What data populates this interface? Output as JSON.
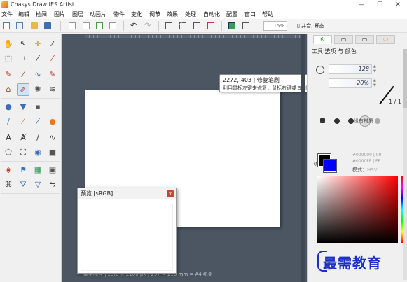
{
  "window": {
    "title": "Chasys Draw IES Artist",
    "min": "—",
    "max": "☐",
    "close": "✕"
  },
  "menu": [
    "文件",
    "编辑",
    "检阅",
    "图片",
    "图层",
    "动画片",
    "物件",
    "变化",
    "调节",
    "效果",
    "处理",
    "自动化",
    "配置",
    "窗口",
    "帮助"
  ],
  "toolbar": {
    "zoom": "15%",
    "merge_label": "并合, 幂态"
  },
  "tooltip": {
    "line1": "2272,-403 | 修复笔刷",
    "line2": "利用鼠标左键来修复，鼠标右键或 Shift 来配置参考"
  },
  "statusbar": {
    "text": "幅平面片 | 29/0 × 2100 px | 297 × 210 mm = A4 纸张"
  },
  "preview": {
    "title": "预览 [sRGB]",
    "close": "x"
  },
  "panel": {
    "tabs": [
      "⚙",
      "▭",
      "▭",
      "⬭"
    ],
    "title": "工具 选项 与 颜色",
    "size_value": "128",
    "opacity_value": "20%",
    "ratio": "1 / 1",
    "no_texture": "没有材质",
    "fg_hex": "#000000 | 00",
    "bg_hex": "#0000FF | FF",
    "mode_label": "模式：",
    "mode_value": "HSV"
  },
  "colors": {
    "foreground": "#000000",
    "background": "#0000ff",
    "accent": "#7fb2de"
  },
  "watermark": "最需教育",
  "tools": [
    {
      "name": "hand-tool",
      "glyph": "✋"
    },
    {
      "name": "pointer-tool",
      "glyph": "↖"
    },
    {
      "name": "move-tool",
      "glyph": "✛"
    },
    {
      "name": "eyedropper-tool",
      "glyph": "⁄"
    },
    {
      "name": "marquee-tool",
      "glyph": "⬚"
    },
    {
      "name": "crop-tool",
      "glyph": "⌗"
    },
    {
      "name": "magic-wand-tool",
      "glyph": "⁄"
    },
    {
      "name": "picker-tool",
      "glyph": "⁄"
    },
    {
      "name": "pencil-tool",
      "glyph": "✎"
    },
    {
      "name": "brush-tool",
      "glyph": "⁄"
    },
    {
      "name": "smudge-tool",
      "glyph": "∿"
    },
    {
      "name": "clone-tool",
      "glyph": "✎"
    },
    {
      "name": "stamp-tool",
      "glyph": "⌂"
    },
    {
      "name": "heal-brush-tool",
      "glyph": "✐"
    },
    {
      "name": "spray-tool",
      "glyph": "✺"
    },
    {
      "name": "pattern-tool",
      "glyph": "≋"
    },
    {
      "name": "drop-tool",
      "glyph": "●"
    },
    {
      "name": "sharpen-tool",
      "glyph": "▼"
    },
    {
      "name": "sponge-tool",
      "glyph": "▪"
    },
    {
      "name": "grid-tool",
      "glyph": ""
    },
    {
      "name": "paint-tool",
      "glyph": "/"
    },
    {
      "name": "fill-tool",
      "glyph": "⁄"
    },
    {
      "name": "blend-tool",
      "glyph": "⁄"
    },
    {
      "name": "ball-tool",
      "glyph": "●"
    },
    {
      "name": "text-tool",
      "glyph": "A"
    },
    {
      "name": "path-text-tool",
      "glyph": "Ⱥ"
    },
    {
      "name": "line-tool",
      "glyph": "/"
    },
    {
      "name": "curve-tool",
      "glyph": "∿"
    },
    {
      "name": "shape-tool",
      "glyph": "⬠"
    },
    {
      "name": "warp-tool",
      "glyph": "⛶"
    },
    {
      "name": "shape-fill-tool",
      "glyph": "◉"
    },
    {
      "name": "cube-tool",
      "glyph": "■"
    },
    {
      "name": "bucket-tool",
      "glyph": "◈"
    },
    {
      "name": "flag-tool",
      "glyph": "⚑"
    },
    {
      "name": "gradient-tool",
      "glyph": "▦"
    },
    {
      "name": "pixel-tool",
      "glyph": "▣"
    },
    {
      "name": "trim-tool",
      "glyph": "⌘"
    },
    {
      "name": "perspective-tool",
      "glyph": "⛛"
    },
    {
      "name": "flip-tool",
      "glyph": "▽"
    },
    {
      "name": "align-tool",
      "glyph": "⇋"
    }
  ]
}
